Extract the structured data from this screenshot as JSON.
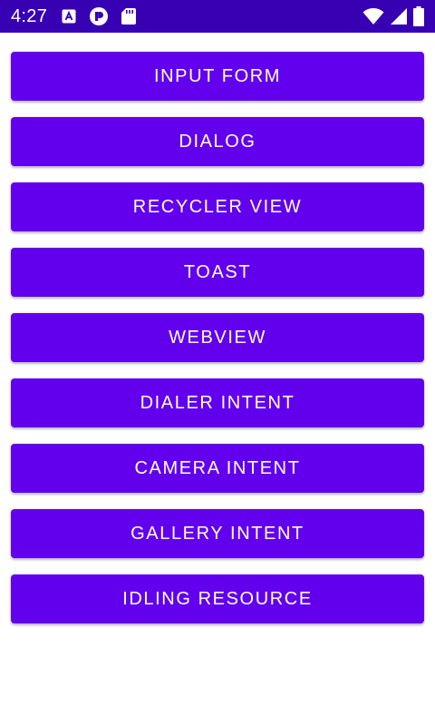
{
  "status_bar": {
    "time": "4:27",
    "left_icons": [
      "keyboard-a-icon",
      "media-icon",
      "sd-card-icon"
    ],
    "right_icons": [
      "wifi-icon",
      "cell-signal-icon",
      "battery-icon"
    ],
    "colors": {
      "background": "#3700b3",
      "foreground": "#ffffff"
    }
  },
  "buttons": [
    {
      "label": "INPUT FORM"
    },
    {
      "label": "DIALOG"
    },
    {
      "label": "RECYCLER VIEW"
    },
    {
      "label": "TOAST"
    },
    {
      "label": "WEBVIEW"
    },
    {
      "label": "DIALER INTENT"
    },
    {
      "label": "CAMERA INTENT"
    },
    {
      "label": "GALLERY INTENT"
    },
    {
      "label": "IDLING RESOURCE"
    }
  ],
  "colors": {
    "button_background": "#6200ee",
    "button_text": "#ffffff",
    "page_background": "#ffffff"
  }
}
